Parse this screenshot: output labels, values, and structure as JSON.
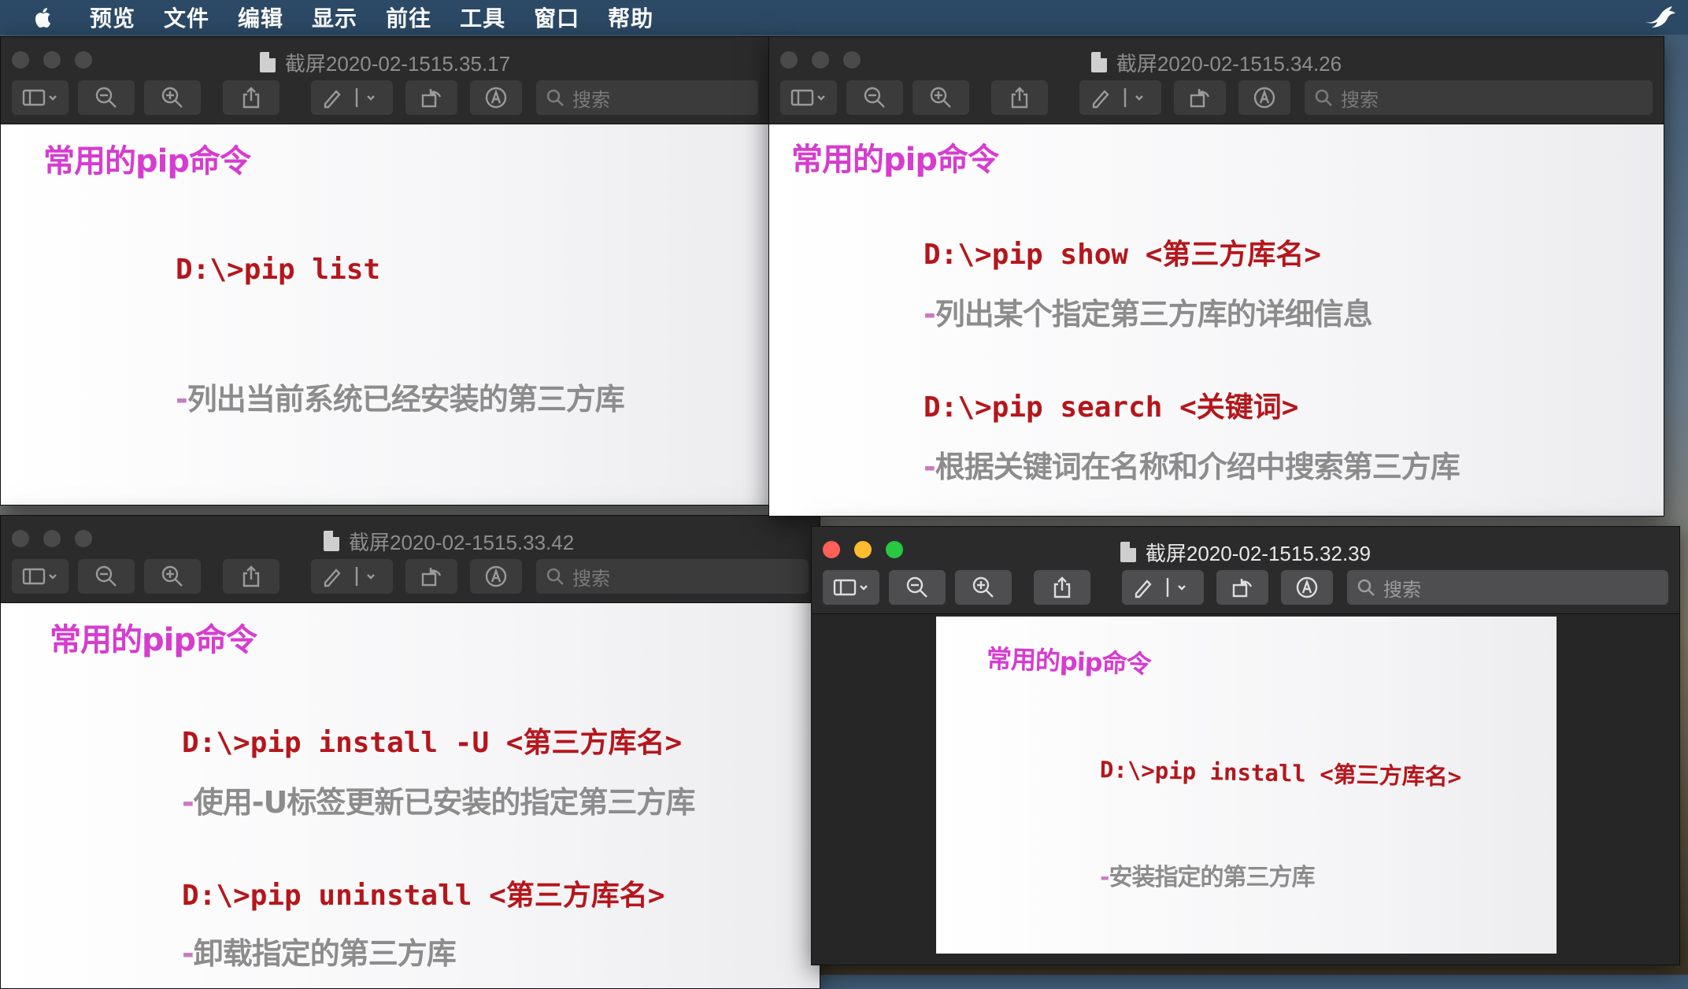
{
  "menubar": {
    "items": [
      "预览",
      "文件",
      "编辑",
      "显示",
      "前往",
      "工具",
      "窗口",
      "帮助"
    ]
  },
  "toolbar": {
    "search_placeholder": "搜索"
  },
  "windows": {
    "w1": {
      "title": "截屏2020-02-1515.35.17",
      "slide_title": "常用的pip命令",
      "cmd1": "D:\\>pip list",
      "desc1": "列出当前系统已经安装的第三方库"
    },
    "w2": {
      "title": "截屏2020-02-1515.34.26",
      "slide_title": "常用的pip命令",
      "cmd1": "D:\\>pip show <第三方库名>",
      "desc1": "列出某个指定第三方库的详细信息",
      "cmd2": "D:\\>pip search <关键词>",
      "desc2": "根据关键词在名称和介绍中搜索第三方库"
    },
    "w3": {
      "title": "截屏2020-02-1515.33.42",
      "slide_title": "常用的pip命令",
      "cmd1": "D:\\>pip install -U <第三方库名>",
      "desc1": "使用-U标签更新已安装的指定第三方库",
      "cmd2": "D:\\>pip uninstall <第三方库名>",
      "desc2": "卸载指定的第三方库"
    },
    "w4": {
      "title": "截屏2020-02-1515.32.39",
      "slide_title": "常用的pip命令",
      "cmd1": "D:\\>pip install <第三方库名>",
      "desc1": "安装指定的第三方库"
    }
  }
}
